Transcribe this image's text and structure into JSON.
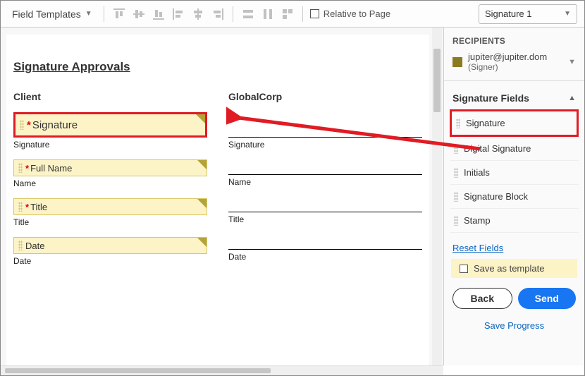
{
  "toolbar": {
    "field_templates_label": "Field Templates",
    "relative_to_page_label": "Relative to Page",
    "recipient_selector": "Signature 1"
  },
  "document": {
    "heading": "Signature Approvals",
    "client_title": "Client",
    "globalcorp_title": "GlobalCorp",
    "labels": {
      "signature": "Signature",
      "name": "Name",
      "title": "Title",
      "date": "Date"
    },
    "fields": {
      "signature": "Signature",
      "full_name": "Full Name",
      "title": "Title",
      "date": "Date"
    }
  },
  "panel": {
    "recipients_title": "RECIPIENTS",
    "recipient_email": "jupiter@jupiter.dom",
    "recipient_role": "(Signer)",
    "signature_fields_title": "Signature Fields",
    "fields": [
      "Signature",
      "Digital Signature",
      "Initials",
      "Signature Block",
      "Stamp"
    ],
    "reset_fields": "Reset Fields",
    "save_as_template": "Save as template",
    "back": "Back",
    "send": "Send",
    "save_progress": "Save Progress"
  }
}
